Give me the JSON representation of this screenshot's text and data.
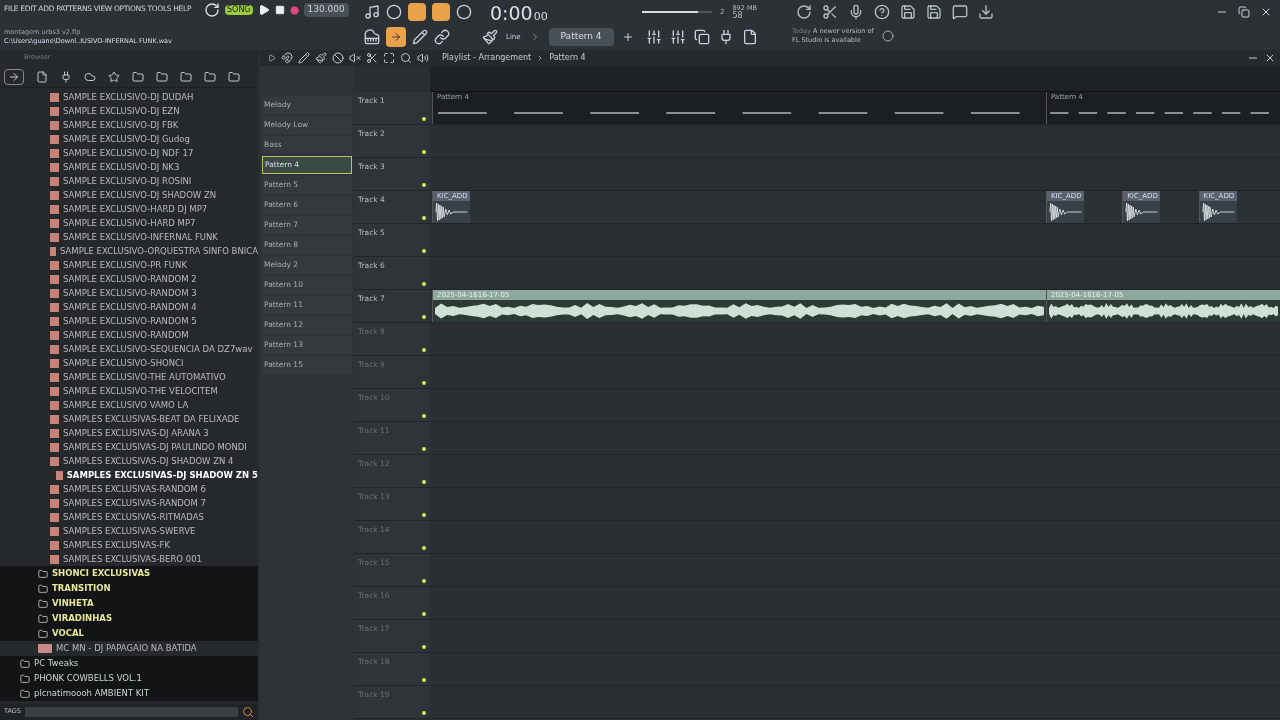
{
  "menu": [
    "FILE",
    "EDIT",
    "ADD",
    "PATTERNS",
    "VIEW",
    "OPTIONS",
    "TOOLS",
    "HELP"
  ],
  "project": {
    "file": "montagem urbs3 v2.flp",
    "hint": "C:\\Users\\guane\\Downl..IUSIVO-INFERNAL FUNK.wav"
  },
  "transport": {
    "mode": "SONG",
    "tempo": "130.000",
    "time": "0:00",
    "time_small": "00",
    "memory": "892 MB",
    "cpu": "58",
    "counter": "2",
    "volume": {
      "level": 0.8
    }
  },
  "snap": "Line",
  "pattern_selector": "Pattern 4",
  "news": {
    "tag": "Today",
    "text": "A newer version of",
    "text2": "FL Studio is available"
  },
  "browser": {
    "title": "Browser",
    "tags_label": "TAGS",
    "items": [
      {
        "label": "SAMPLE EXCLUSIVO-DJ DUDAH",
        "kind": "sample",
        "selected": false
      },
      {
        "label": "SAMPLE EXCLUSIVO-DJ EZN",
        "kind": "sample",
        "selected": false
      },
      {
        "label": "SAMPLE EXCLUSIVO-DJ FBK",
        "kind": "sample",
        "selected": false
      },
      {
        "label": "SAMPLE EXCLUSIVO-DJ Gudog",
        "kind": "sample",
        "selected": false
      },
      {
        "label": "SAMPLE EXCLUSIVO-DJ NDF 17",
        "kind": "sample",
        "selected": false
      },
      {
        "label": "SAMPLE EXCLUSIVO-DJ NK3",
        "kind": "sample",
        "selected": false
      },
      {
        "label": "SAMPLE EXCLUSIVO-DJ ROSINI",
        "kind": "sample",
        "selected": false
      },
      {
        "label": "SAMPLE EXCLUSIVO-DJ SHADOW ZN",
        "kind": "sample",
        "selected": false
      },
      {
        "label": "SAMPLE EXCLUSIVO-HARD DJ MP7",
        "kind": "sample",
        "selected": false
      },
      {
        "label": "SAMPLE EXCLUSIVO-HARD MP7",
        "kind": "sample",
        "selected": false
      },
      {
        "label": "SAMPLE EXCLUSIVO-INFERNAL FUNK",
        "kind": "sample",
        "selected": false
      },
      {
        "label": "SAMPLE EXCLUSIVO-ORQUESTRA SINFO BNICA",
        "kind": "sample",
        "selected": false
      },
      {
        "label": "SAMPLE EXCLUSIVO-PR FUNK",
        "kind": "sample",
        "selected": false
      },
      {
        "label": "SAMPLE EXCLUSIVO-RANDOM 2",
        "kind": "sample",
        "selected": false
      },
      {
        "label": "SAMPLE EXCLUSIVO-RANDOM 3",
        "kind": "sample",
        "selected": false
      },
      {
        "label": "SAMPLE EXCLUSIVO-RANDOM 4",
        "kind": "sample",
        "selected": false
      },
      {
        "label": "SAMPLE EXCLUSIVO-RANDOM 5",
        "kind": "sample",
        "selected": false
      },
      {
        "label": "SAMPLE EXCLUSIVO-RANDOM",
        "kind": "sample",
        "selected": false
      },
      {
        "label": "SAMPLE EXCLUSIVO-SEQUENCIA DA DZ7wav",
        "kind": "sample",
        "selected": false
      },
      {
        "label": "SAMPLE EXCLUSIVO-SHONCI",
        "kind": "sample",
        "selected": false
      },
      {
        "label": "SAMPLE EXCLUSIVO-THE AUTOMATIVO",
        "kind": "sample",
        "selected": false
      },
      {
        "label": "SAMPLE EXCLUSIVO-THE VELOCITEM",
        "kind": "sample",
        "selected": false
      },
      {
        "label": "SAMPLE EXCLUSIVO VAMO LA",
        "kind": "sample",
        "selected": false
      },
      {
        "label": "SAMPLES EXCLUSIVAS-BEAT DA FELIXADE",
        "kind": "sample",
        "selected": false
      },
      {
        "label": "SAMPLES EXCLUSIVAS-DJ ARANA 3",
        "kind": "sample",
        "selected": false
      },
      {
        "label": "SAMPLES EXCLUSIVAS-DJ PAULINDO MONDI",
        "kind": "sample",
        "selected": false
      },
      {
        "label": "SAMPLES EXCLUSIVAS-DJ SHADOW ZN 4",
        "kind": "sample",
        "selected": false
      },
      {
        "label": "SAMPLES EXCLUSIVAS-DJ SHADOW ZN 5",
        "kind": "sample",
        "selected": true
      },
      {
        "label": "SAMPLES EXCLUSIVAS-RANDOM 6",
        "kind": "sample",
        "selected": false
      },
      {
        "label": "SAMPLES EXCLUSIVAS-RANDOM 7",
        "kind": "sample",
        "selected": false
      },
      {
        "label": "SAMPLES EXCLUSIVAS-RITMADAS",
        "kind": "sample",
        "selected": false
      },
      {
        "label": "SAMPLES EXCLUSIVAS-SWERVE",
        "kind": "sample",
        "selected": false
      },
      {
        "label": "SAMPLES EXCLUSIVAS-FK",
        "kind": "sample",
        "selected": false
      },
      {
        "label": "SAMPLES EXCLUSIVAS-BERO 001",
        "kind": "sample",
        "selected": false
      },
      {
        "label": "SHONCI EXCLUSIVAS",
        "kind": "folder",
        "selected": false
      },
      {
        "label": "TRANSITION",
        "kind": "folder",
        "selected": false
      },
      {
        "label": "VINHETA",
        "kind": "folder",
        "selected": false
      },
      {
        "label": "VIRADINHAS",
        "kind": "folder",
        "selected": false
      },
      {
        "label": "VOCAL",
        "kind": "folder",
        "selected": false
      },
      {
        "label": "MC MN - DJ PAPAGAIO NA BATIDA",
        "kind": "audio",
        "selected": false
      },
      {
        "label": "PC Tweaks",
        "kind": "root",
        "selected": false
      },
      {
        "label": "PHONK COWBELLS VOL.1",
        "kind": "root",
        "selected": false
      },
      {
        "label": "plcnatimoooh AMBIENT KIT",
        "kind": "root",
        "selected": false
      }
    ]
  },
  "playlist": {
    "title": "Playlist - Arrangement",
    "pattern": "Pattern 4",
    "patterns": [
      {
        "label": "Melody",
        "selected": false
      },
      {
        "label": "Melody Low",
        "selected": false
      },
      {
        "label": "Bass",
        "selected": false
      },
      {
        "label": "Pattern 4",
        "selected": true
      },
      {
        "label": "Pattern 5",
        "selected": false
      },
      {
        "label": "Pattern 6",
        "selected": false
      },
      {
        "label": "Pattern 7",
        "selected": false
      },
      {
        "label": "Pattern 8",
        "selected": false
      },
      {
        "label": "Melody 2",
        "selected": false
      },
      {
        "label": "Pattern 10",
        "selected": false
      },
      {
        "label": "Pattern 11",
        "selected": false
      },
      {
        "label": "Pattern 12",
        "selected": false
      },
      {
        "label": "Pattern 13",
        "selected": false
      },
      {
        "label": "Pattern 15",
        "selected": false
      }
    ],
    "tracks": [
      {
        "name": "Track 1",
        "clips": [
          {
            "kind": "pattern",
            "label": "Pattern 4"
          },
          {
            "kind": "pattern",
            "label": "Pattern 4"
          }
        ]
      },
      {
        "name": "Track 2"
      },
      {
        "name": "Track 3"
      },
      {
        "name": "Track 4",
        "clips": [
          {
            "kind": "sample",
            "label": "KIC_ADD"
          },
          {
            "kind": "sample",
            "label": "KIC_ADD"
          },
          {
            "kind": "sample",
            "label": "KIC_ADD"
          },
          {
            "kind": "sample",
            "label": "KIC_ADD"
          }
        ]
      },
      {
        "name": "Track 5"
      },
      {
        "name": "Track 6"
      },
      {
        "name": "Track 7",
        "clips": [
          {
            "kind": "audio",
            "label": "2025-04-1616-17-05"
          },
          {
            "kind": "audio",
            "label": "2025-04-1616-17-05"
          }
        ]
      },
      {
        "name": "Track 8"
      },
      {
        "name": "Track 9"
      },
      {
        "name": "Track 10"
      },
      {
        "name": "Track 11"
      },
      {
        "name": "Track 12"
      },
      {
        "name": "Track 13"
      },
      {
        "name": "Track 14"
      },
      {
        "name": "Track 15"
      },
      {
        "name": "Track 16"
      },
      {
        "name": "Track 17"
      },
      {
        "name": "Track 18"
      },
      {
        "name": "Track 19"
      }
    ]
  }
}
